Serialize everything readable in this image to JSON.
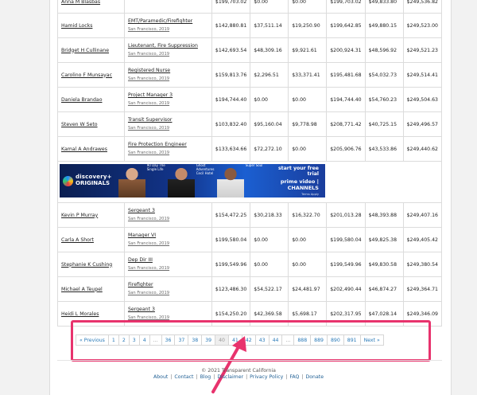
{
  "table": {
    "rows": [
      {
        "name": "Anna M Blasbas",
        "title": "",
        "location": "",
        "base": "$199,703.02",
        "overtime": "$0.00",
        "other": "$0.00",
        "total": "$199,703.02",
        "benefits": "$49,833.80",
        "grand": "$249,536.82"
      },
      {
        "name": "Hamid Locks",
        "title": "EMT/Paramedic/Firefighter",
        "location": "San Francisco, 2019",
        "base": "$142,880.81",
        "overtime": "$37,511.14",
        "other": "$19,250.90",
        "total": "$199,642.85",
        "benefits": "$49,880.15",
        "grand": "$249,523.00"
      },
      {
        "name": "Bridget H Cullinane",
        "title": "Lieutenant, Fire Suppression",
        "location": "San Francisco, 2019",
        "base": "$142,693.54",
        "overtime": "$48,309.16",
        "other": "$9,921.61",
        "total": "$200,924.31",
        "benefits": "$48,596.92",
        "grand": "$249,521.23"
      },
      {
        "name": "Carolino F Munsayac",
        "title": "Registered Nurse",
        "location": "San Francisco, 2019",
        "base": "$159,813.76",
        "overtime": "$2,296.51",
        "other": "$33,371.41",
        "total": "$195,481.68",
        "benefits": "$54,032.73",
        "grand": "$249,514.41"
      },
      {
        "name": "Daniela Brandao",
        "title": "Project Manager 3",
        "location": "San Francisco, 2019",
        "base": "$194,744.40",
        "overtime": "$0.00",
        "other": "$0.00",
        "total": "$194,744.40",
        "benefits": "$54,760.23",
        "grand": "$249,504.63"
      },
      {
        "name": "Steven W Seto",
        "title": "Transit Supervisor",
        "location": "San Francisco, 2019",
        "base": "$103,832.40",
        "overtime": "$95,160.04",
        "other": "$9,778.98",
        "total": "$208,771.42",
        "benefits": "$40,725.15",
        "grand": "$249,496.57"
      },
      {
        "name": "Kamal A Andrawes",
        "title": "Fire Protection Engineer",
        "location": "San Francisco, 2019",
        "base": "$133,634.66",
        "overtime": "$72,272.10",
        "other": "$0.00",
        "total": "$205,906.76",
        "benefits": "$43,533.86",
        "grand": "$249,440.62"
      }
    ],
    "rows_after_ad": [
      {
        "name": "Kevin P Murray",
        "title": "Sergeant 3",
        "location": "San Francisco, 2019",
        "base": "$154,472.25",
        "overtime": "$30,218.33",
        "other": "$16,322.70",
        "total": "$201,013.28",
        "benefits": "$48,393.88",
        "grand": "$249,407.16"
      },
      {
        "name": "Carla A Short",
        "title": "Manager VI",
        "location": "San Francisco, 2019",
        "base": "$199,580.04",
        "overtime": "$0.00",
        "other": "$0.00",
        "total": "$199,580.04",
        "benefits": "$49,825.38",
        "grand": "$249,405.42"
      },
      {
        "name": "Stephanie K Cushing",
        "title": "Dep Dir III",
        "location": "San Francisco, 2019",
        "base": "$199,549.96",
        "overtime": "$0.00",
        "other": "$0.00",
        "total": "$199,549.96",
        "benefits": "$49,830.58",
        "grand": "$249,380.54"
      },
      {
        "name": "Michael A Teupel",
        "title": "Firefighter",
        "location": "San Francisco, 2019",
        "base": "$123,486.30",
        "overtime": "$54,522.17",
        "other": "$24,481.97",
        "total": "$202,490.44",
        "benefits": "$46,874.27",
        "grand": "$249,364.71"
      },
      {
        "name": "Heidi L Morales",
        "title": "Sergeant 3",
        "location": "San Francisco, 2019",
        "base": "$154,250.20",
        "overtime": "$42,369.58",
        "other": "$5,698.17",
        "total": "$202,317.95",
        "benefits": "$47,028.14",
        "grand": "$249,346.09"
      }
    ]
  },
  "ad": {
    "brand": "discovery+",
    "sub": "ORIGINALS",
    "tag1": "90 Day The Single Life",
    "tag2": "Ghost Adventures Cecil Hotel",
    "tag3": "Super Soul",
    "cta": "start your free trial",
    "prime": "prime video | CHANNELS",
    "fine": "Terms Apply"
  },
  "pagination": {
    "prev": "« Previous",
    "next": "Next »",
    "pages": [
      "1",
      "2",
      "3",
      "4",
      "...",
      "36",
      "37",
      "38",
      "39",
      "40",
      "41",
      "42",
      "43",
      "44",
      "...",
      "888",
      "889",
      "890",
      "891"
    ],
    "active": "40"
  },
  "footer": {
    "copyright": "© 2021 Transparent California",
    "links": [
      "About",
      "Contact",
      "Blog",
      "Disclaimer",
      "Privacy Policy",
      "FAQ",
      "Donate"
    ],
    "separator": "|"
  },
  "annotation": {
    "highlight_color": "#e8336d"
  }
}
